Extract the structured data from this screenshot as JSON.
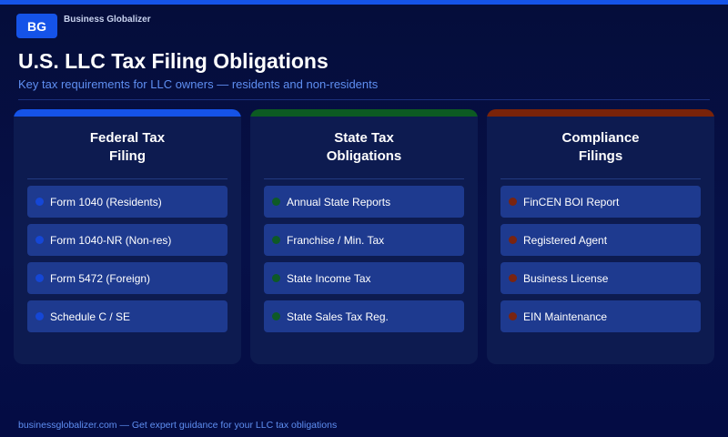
{
  "brand": {
    "logo_text": "BG",
    "name": "Business Globalizer"
  },
  "header": {
    "title": "U.S. LLC Tax Filing Obligations",
    "subtitle": "Key tax requirements for LLC owners — residents and non-residents"
  },
  "cards": [
    {
      "title_line1": "Federal Tax",
      "title_line2": "Filing",
      "accent_color": "#1553e8",
      "dot_color": "#1547d6",
      "items": [
        "Form 1040 (Residents)",
        "Form 1040-NR (Non-res)",
        "Form 5472 (Foreign)",
        "Schedule C / SE"
      ]
    },
    {
      "title_line1": "State Tax",
      "title_line2": "Obligations",
      "accent_color": "#0c5a22",
      "dot_color": "#0e5a26",
      "items": [
        "Annual State Reports",
        "Franchise / Min. Tax",
        "State Income Tax",
        "State Sales Tax Reg."
      ]
    },
    {
      "title_line1": "Compliance",
      "title_line2": "Filings",
      "accent_color": "#7a2309",
      "dot_color": "#7a2410",
      "items": [
        "FinCEN BOI Report",
        "Registered Agent",
        "Business License",
        "EIN Maintenance"
      ]
    }
  ],
  "footer": {
    "text": "businessglobalizer.com — Get expert guidance for your LLC tax obligations"
  }
}
